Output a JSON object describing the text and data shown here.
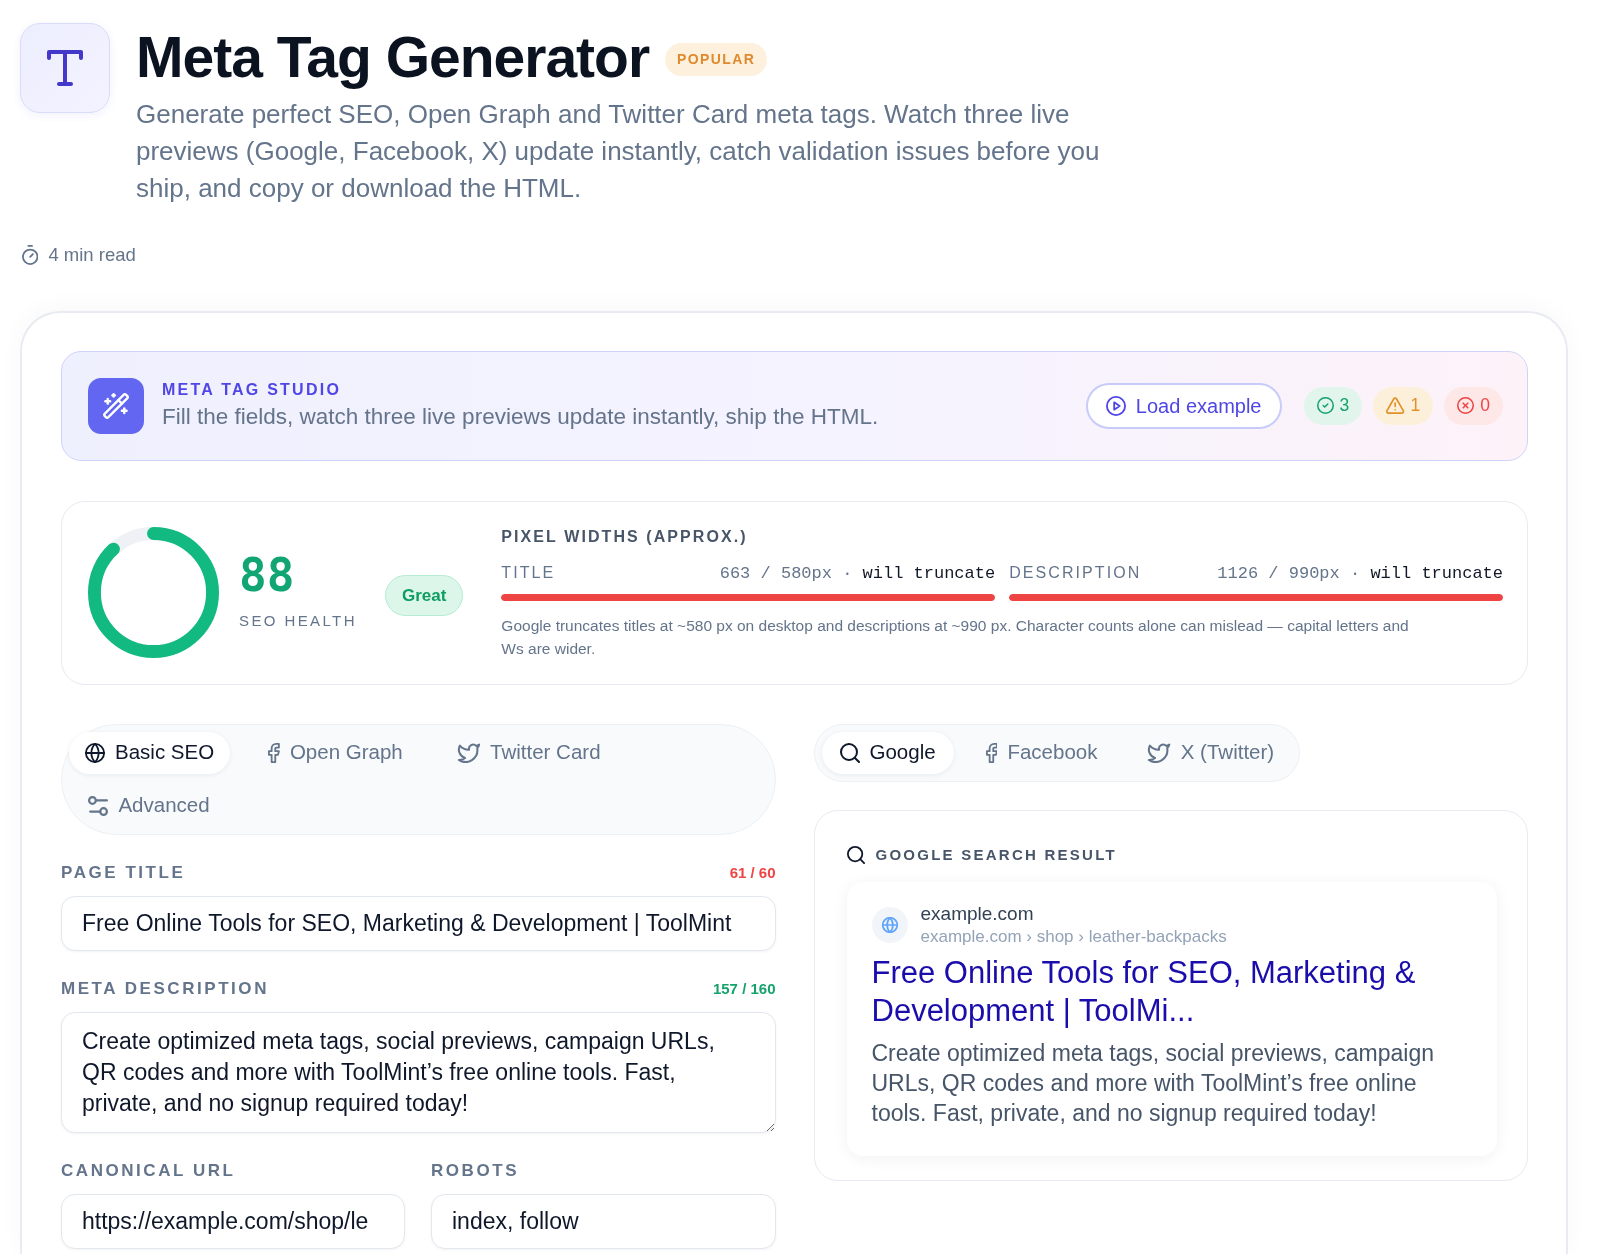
{
  "header": {
    "title": "Meta Tag Generator",
    "badge": "POPULAR",
    "description": "Generate perfect SEO, Open Graph and Twitter Card meta tags. Watch three live previews (Google, Facebook, X) update instantly, catch validation issues before you ship, and copy or download the HTML.",
    "read_time": "4 min read"
  },
  "studio": {
    "eyebrow": "META TAG STUDIO",
    "subtitle": "Fill the fields, watch three live previews update instantly, ship the HTML.",
    "load_button": "Load example",
    "checks": [
      {
        "kind": "pass",
        "count": "3"
      },
      {
        "kind": "warning",
        "count": "1"
      },
      {
        "kind": "error",
        "count": "0"
      }
    ]
  },
  "health": {
    "score": "88",
    "level": 0.88,
    "label": "SEO HEALTH",
    "rating": "Great",
    "widths_heading": "PIXEL WIDTHS (APPROX.)",
    "widths": [
      {
        "name": "TITLE",
        "reading": "663 / 580px · **will truncate**",
        "level": 1,
        "over": true
      },
      {
        "name": "DESCRIPTION",
        "reading": "1126 / 990px · **will truncate**",
        "level": 1,
        "over": true
      }
    ],
    "note": "Google truncates titles at ~580 px on desktop and descriptions at ~990 px. Character counts alone can mislead — capital letters and Ws are wider."
  },
  "editor_tabs": [
    {
      "label": "Basic SEO",
      "selected": true
    },
    {
      "label": "Open Graph",
      "selected": false
    },
    {
      "label": "Twitter Card",
      "selected": false
    },
    {
      "label": "Advanced",
      "selected": false
    }
  ],
  "form": {
    "page_title": {
      "label": "PAGE TITLE",
      "counter": "61 / 60",
      "over_limit": true,
      "value": "Free Online Tools for SEO, Marketing & Development | ToolMint"
    },
    "meta_description": {
      "label": "META DESCRIPTION",
      "counter": "157 / 160",
      "over_limit": false,
      "value": "Create optimized meta tags, social previews, campaign URLs, QR codes and more with ToolMint’s free online tools. Fast, private, and no signup required today!"
    },
    "canonical_url": {
      "label": "CANONICAL URL",
      "value": "https://example.com/shop/le"
    },
    "robots": {
      "label": "ROBOTS",
      "value": "index, follow"
    }
  },
  "preview_tabs": [
    {
      "label": "Google",
      "selected": true
    },
    {
      "label": "Facebook",
      "selected": false
    },
    {
      "label": "X (Twitter)",
      "selected": false
    }
  ],
  "preview": {
    "heading": "GOOGLE SEARCH RESULT",
    "site": "example.com",
    "breadcrumb": "example.com › shop › leather-backpacks",
    "title": "Free Online Tools for SEO, Marketing & Development | ToolMi...",
    "description": "Create optimized meta tags, social previews, campaign URLs, QR codes and more with ToolMint’s free online tools. Fast, private, and no signup required today!"
  }
}
